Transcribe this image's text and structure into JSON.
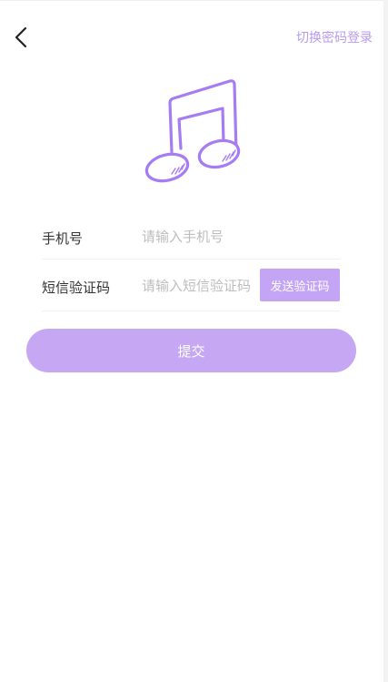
{
  "header": {
    "back_icon": "chevron-left-icon",
    "switch_login_label": "切换密码登录"
  },
  "logo": {
    "icon": "music-note-icon",
    "color": "#a57cf2"
  },
  "form": {
    "phone": {
      "label": "手机号",
      "placeholder": "请输入手机号",
      "value": ""
    },
    "sms_code": {
      "label": "短信验证码",
      "placeholder": "请输入短信验证码",
      "value": "",
      "send_button_label": "发送验证码"
    },
    "submit_label": "提交"
  },
  "colors": {
    "accent": "#c5a7f3",
    "link": "#b79bf0",
    "icon_stroke": "#a57cf2"
  }
}
